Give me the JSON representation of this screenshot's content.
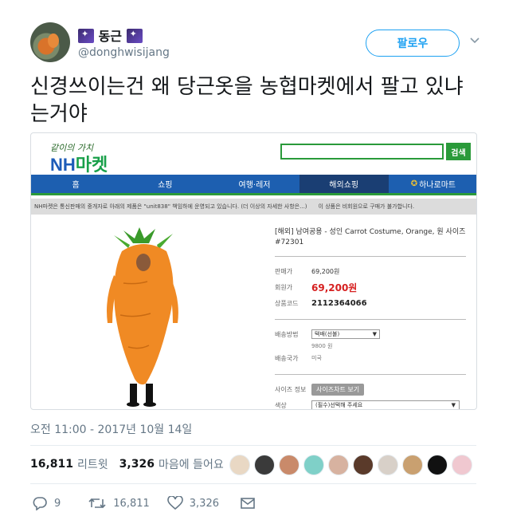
{
  "tweet": {
    "display_name": "동근",
    "handle": "@donghwisijang",
    "follow_label": "팔로우",
    "text": "신경쓰이는건 왜 당근옷을 농협마켓에서 팔고 있냐는거야",
    "timestamp": "오전 11:00 - 2017년 10월 14일",
    "stats": {
      "retweets_count": "16,811",
      "retweets_label": "리트윗",
      "likes_count": "3,326",
      "likes_label": "마음에 들어요"
    },
    "liker_colors": [
      "#e9d8c4",
      "#3a3a3a",
      "#c98a6a",
      "#7fd0c8",
      "#d7b2a0",
      "#5a3a2a",
      "#d8d0c8",
      "#c9a070",
      "#111111",
      "#f0c8d0"
    ],
    "actions": {
      "reply_count": "9",
      "retweet_count": "16,811",
      "like_count": "3,326"
    }
  },
  "media": {
    "logo_tagline": "같이의 가치",
    "logo_nh": "NH",
    "logo_market": "마켓",
    "search_button": "검색",
    "nav": [
      "홈",
      "쇼핑",
      "여행·레저",
      "해외쇼핑",
      "하나로마트"
    ],
    "notice_left": "NH마켓은 통신판매의 중개자로 아래의 제품은 \"unit838\" 책임하에 운영되고 있습니다. (더 이상의 자세한 사항은...)",
    "notice_right": "이 상품은 비회원으로 구매가 불가합니다.",
    "product": {
      "title": "[해외] 남여공용 - 성인 Carrot Costume, Orange, 원 사이즈 #72301",
      "regular_price_label": "판매가",
      "regular_price": "69,200원",
      "sale_price_label": "회원가",
      "sale_price": "69,200원",
      "code_label": "상품코드",
      "code": "2112364066",
      "shipping_label": "배송방법",
      "shipping_value": "택배(선불)",
      "shipping_fee": "9800 원",
      "origin_label": "배송국가",
      "origin_value": "미국",
      "size_label": "사이즈 정보",
      "size_button": "사이즈차트 보기",
      "option_label": "색상",
      "option_value": "(필수)선택해 주세요"
    }
  }
}
